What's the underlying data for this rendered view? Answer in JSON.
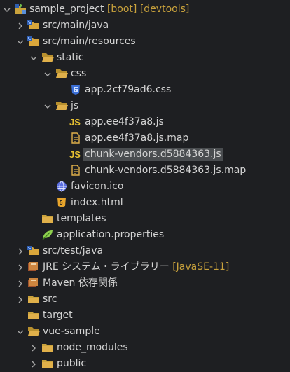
{
  "tree": [
    {
      "label": "sample_project",
      "meta": "[boot] [devtools]",
      "icon": "project-icon",
      "arrow": "expanded"
    },
    {
      "label": "src/main/java",
      "icon": "source-folder-icon",
      "arrow": "collapsed"
    },
    {
      "label": "src/main/resources",
      "icon": "source-folder-icon",
      "arrow": "expanded"
    },
    {
      "label": "static",
      "icon": "folder-open-icon",
      "arrow": "expanded"
    },
    {
      "label": "css",
      "icon": "folder-open-icon",
      "arrow": "expanded"
    },
    {
      "label": "app.2cf79ad6.css",
      "icon": "css-file-icon"
    },
    {
      "label": "js",
      "icon": "folder-open-icon",
      "arrow": "expanded"
    },
    {
      "label": "app.ee4f37a8.js",
      "icon": "js-file-icon"
    },
    {
      "label": "app.ee4f37a8.js.map",
      "icon": "text-file-icon"
    },
    {
      "label": "chunk-vendors.d5884363.js",
      "icon": "js-file-icon",
      "selected": true
    },
    {
      "label": "chunk-vendors.d5884363.js.map",
      "icon": "text-file-icon"
    },
    {
      "label": "favicon.ico",
      "icon": "globe-icon"
    },
    {
      "label": "index.html",
      "icon": "html-file-icon"
    },
    {
      "label": "templates",
      "icon": "folder-icon"
    },
    {
      "label": "application.properties",
      "icon": "properties-icon"
    },
    {
      "label": "src/test/java",
      "icon": "source-folder-icon",
      "arrow": "collapsed"
    },
    {
      "label": "JRE システム・ライブラリー",
      "meta": "[JavaSE-11]",
      "icon": "library-icon",
      "arrow": "collapsed"
    },
    {
      "label": "Maven 依存関係",
      "icon": "library-icon",
      "arrow": "collapsed"
    },
    {
      "label": "src",
      "icon": "folder-icon",
      "arrow": "collapsed"
    },
    {
      "label": "target",
      "icon": "folder-icon"
    },
    {
      "label": "vue-sample",
      "icon": "folder-open-icon",
      "arrow": "expanded"
    },
    {
      "label": "node_modules",
      "icon": "folder-icon",
      "arrow": "collapsed"
    },
    {
      "label": "public",
      "icon": "folder-icon",
      "arrow": "collapsed"
    }
  ]
}
